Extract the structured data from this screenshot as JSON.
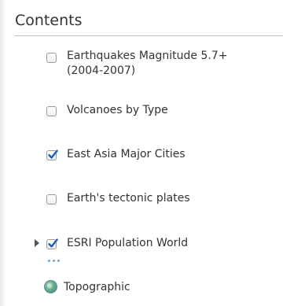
{
  "panel": {
    "title": "Contents"
  },
  "layers": [
    {
      "label_line1": "Earthquakes Magnitude 5.7+",
      "label_line2": "(2004-2007)",
      "checked": false
    },
    {
      "label": "Volcanoes by Type",
      "checked": false
    },
    {
      "label": "East Asia Major Cities",
      "checked": true
    },
    {
      "label": "Earth's tectonic plates",
      "checked": false
    },
    {
      "label": "ESRI Population World",
      "checked": true,
      "expandable": true
    }
  ],
  "basemap": {
    "label": "Topographic",
    "icon": "globe-icon"
  },
  "colors": {
    "check": "#1a5fb4",
    "more_dots": "#6ea8dc"
  }
}
